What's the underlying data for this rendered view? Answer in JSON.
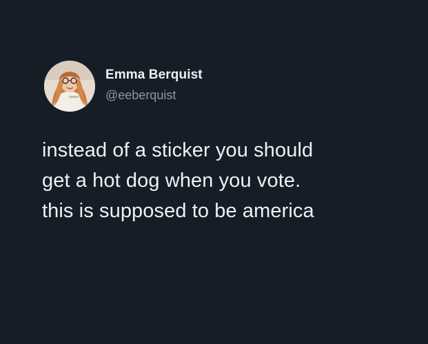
{
  "tweet": {
    "author": {
      "name": "Emma Berquist",
      "handle": "@eeberquist",
      "avatar_icon": "profile-photo"
    },
    "text_lines": [
      "instead of a sticker you should",
      "get a hot dog when you vote.",
      "this is supposed to be america"
    ]
  },
  "colors": {
    "background": "#161d27",
    "primary_text": "#eef1f4",
    "secondary_text": "#8d98a4"
  }
}
